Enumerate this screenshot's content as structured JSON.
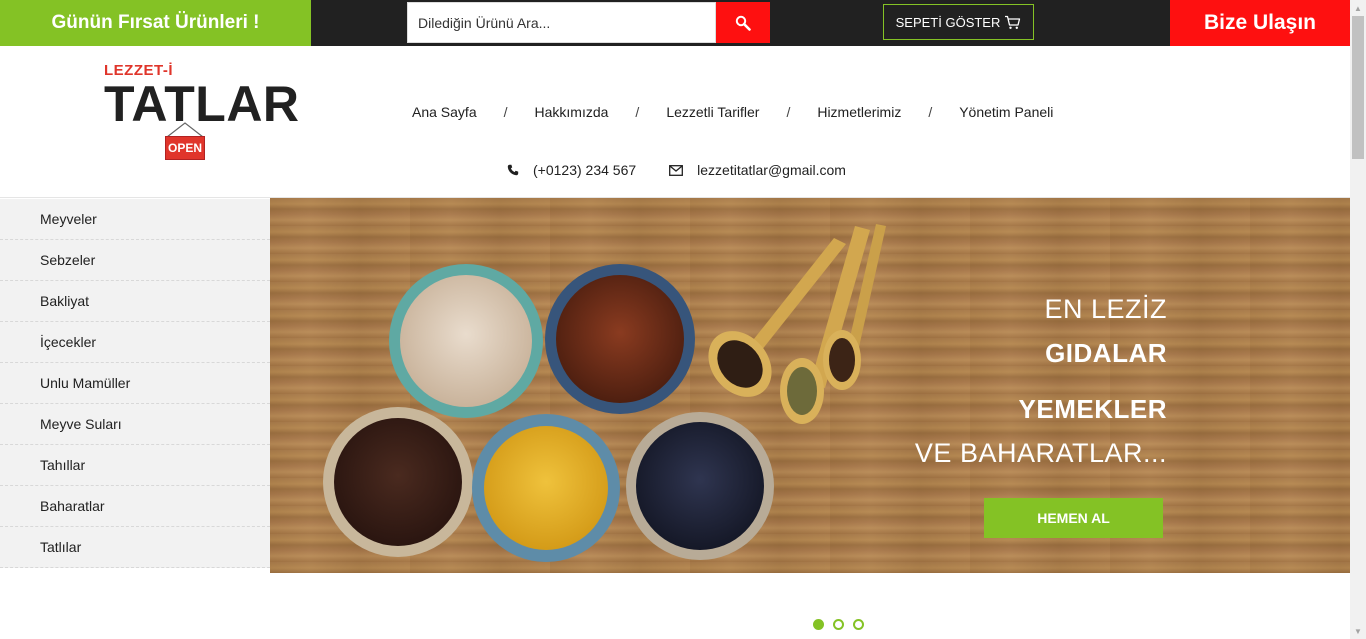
{
  "topbar": {
    "deal_label": "Günün Fırsat Ürünleri !",
    "search_placeholder": "Dilediğin Ürünü Ara...",
    "cart_label": "SEPETİ GÖSTER",
    "contact_label": "Bize Ulaşın"
  },
  "logo": {
    "small": "LEZZET-İ",
    "big": "TATLAR",
    "sign": "OPEN"
  },
  "nav": {
    "items": [
      "Ana Sayfa",
      "Hakkımızda",
      "Lezzetli Tarifler",
      "Hizmetlerimiz",
      "Yönetim Paneli"
    ],
    "separator": "/"
  },
  "contact": {
    "phone": "(+0123) 234 567",
    "email": "lezzetitatlar@gmail.com"
  },
  "sidebar": {
    "items": [
      "Meyveler",
      "Sebzeler",
      "Bakliyat",
      "İçecekler",
      "Unlu Mamüller",
      "Meyve Suları",
      "Tahıllar",
      "Baharatlar",
      "Tatlılar"
    ]
  },
  "banner": {
    "line1": "EN LEZİZ",
    "line2": "GIDALAR",
    "line3": "YEMEKLER",
    "line4": "VE BAHARATLAR...",
    "button": "HEMEN AL"
  },
  "slider": {
    "count": 3,
    "active": 1
  },
  "colors": {
    "green": "#84c225",
    "red": "#fe1010",
    "dark": "#212121"
  }
}
